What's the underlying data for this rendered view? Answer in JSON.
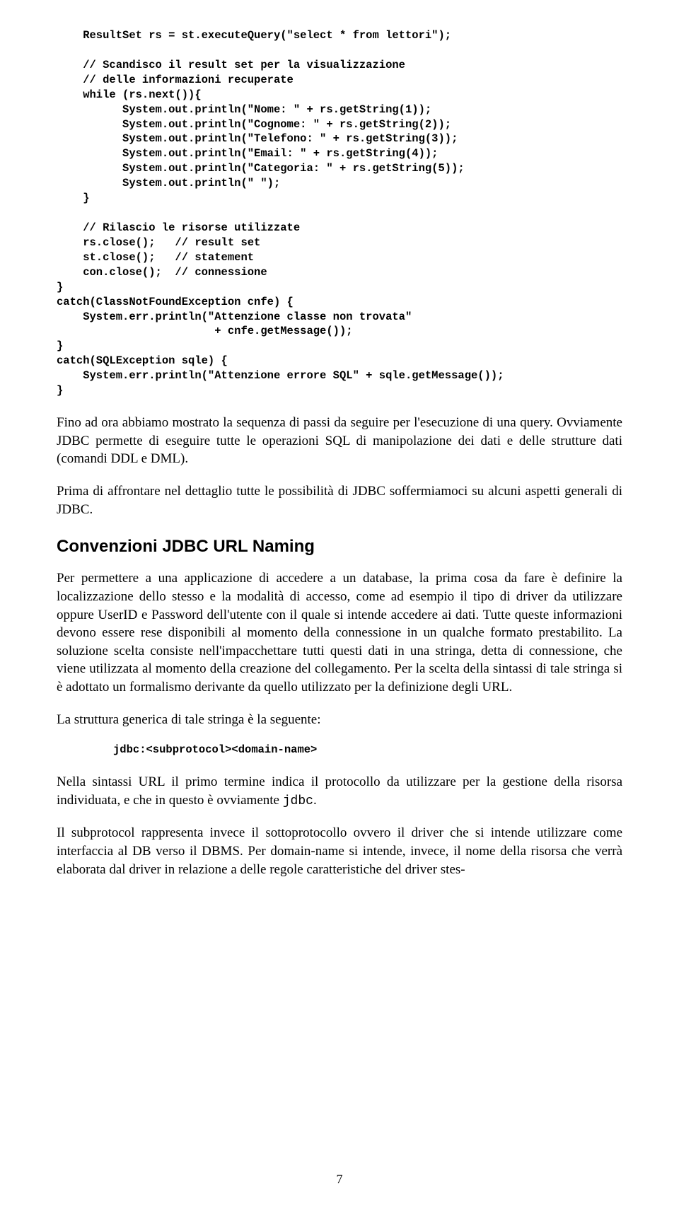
{
  "code_block_1": "    ResultSet rs = st.executeQuery(\"select * from lettori\");\n\n    // Scandisco il result set per la visualizzazione\n    // delle informazioni recuperate\n    while (rs.next()){\n          System.out.println(\"Nome: \" + rs.getString(1));\n          System.out.println(\"Cognome: \" + rs.getString(2));\n          System.out.println(\"Telefono: \" + rs.getString(3));\n          System.out.println(\"Email: \" + rs.getString(4));\n          System.out.println(\"Categoria: \" + rs.getString(5));\n          System.out.println(\" \");\n    }\n\n    // Rilascio le risorse utilizzate\n    rs.close();   // result set\n    st.close();   // statement\n    con.close();  // connessione\n}\ncatch(ClassNotFoundException cnfe) {\n    System.err.println(\"Attenzione classe non trovata\"\n                        + cnfe.getMessage());\n}\ncatch(SQLException sqle) {\n    System.err.println(\"Attenzione errore SQL\" + sqle.getMessage());\n}",
  "para1": "Fino ad ora abbiamo mostrato la sequenza di passi da seguire per l'esecuzione di una query. Ovviamente JDBC permette di eseguire tutte le operazioni SQL di manipolazione dei dati e delle strutture dati (comandi DDL e DML).",
  "para2": "Prima di affrontare nel dettaglio tutte le possibilità di JDBC soffermiamoci su alcuni aspetti generali di JDBC.",
  "heading1": "Convenzioni JDBC URL Naming",
  "para3": "Per permettere a una applicazione di accedere a un database, la prima cosa da fare è definire la localizzazione dello stesso e la modalità di accesso, come ad esempio il tipo di driver da utilizzare oppure UserID e Password dell'utente con il quale si intende accedere ai dati. Tutte queste informazioni devono essere rese disponibili al momento della connessione in un qualche formato prestabilito. La soluzione scelta consiste nell'impacchettare tutti questi dati in una stringa, detta di connessione, che viene utilizzata al momento della creazione del collegamento. Per la scelta della sintassi di tale stringa si è adottato un formalismo derivante da quello utilizzato per la definizione degli URL.",
  "para4": "La struttura generica di tale stringa è la seguente:",
  "code_block_2": "jdbc:<subprotocol><domain-name>",
  "para5_a": "Nella sintassi URL il primo termine indica il protocollo da utilizzare per la gestione della risorsa individuata, e che in questo è ovviamente ",
  "para5_code": "jdbc",
  "para5_b": ".",
  "para6": "Il subprotocol rappresenta invece il sottoprotocollo ovvero il driver che si intende utilizzare come interfaccia al DB verso il DBMS. Per domain-name si intende, invece, il nome della risorsa che verrà elaborata dal driver in relazione a delle regole caratteristiche del driver stes-",
  "page_number": "7"
}
